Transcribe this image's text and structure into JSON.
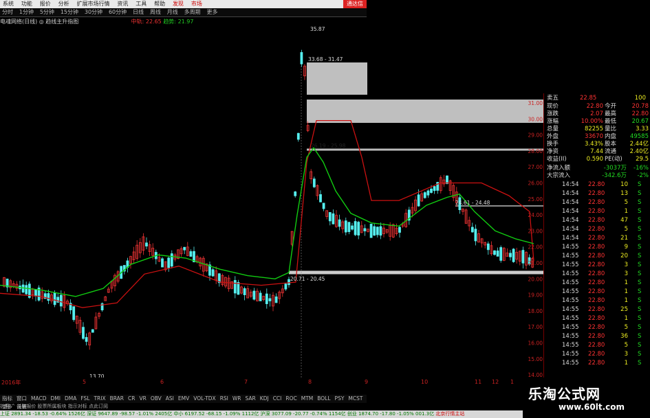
{
  "menu": {
    "items": [
      "系统",
      "功能",
      "报价",
      "分析",
      "扩展市场行情",
      "资讯",
      "工具",
      "帮助"
    ],
    "highlight": [
      "发现",
      "市场"
    ],
    "close": "通达信"
  },
  "periods": [
    "分时",
    "1分钟",
    "5分钟",
    "15分钟",
    "30分钟",
    "60分钟",
    "日线",
    "周线",
    "月线",
    "多周期",
    "更多"
  ],
  "info": {
    "title": "电魂网络(日线) ◎ 趋线主升指图",
    "mid_label": "中轨:",
    "mid_value": "22.65",
    "trend_label": "趋势:",
    "trend_value": "21.97"
  },
  "chart": {
    "y_labels": [
      "31.00",
      "30.00",
      "29.00",
      "28.00",
      "27.00",
      "26.00",
      "25.00",
      "24.00",
      "23.00",
      "22.00",
      "21.00",
      "20.00",
      "19.00",
      "18.00",
      "17.00",
      "16.00",
      "15.00",
      "14.00"
    ],
    "annotations": {
      "high": "35.87",
      "low": "13.70",
      "zone1": "33.68 - 31.47",
      "zone2": "26.19 - 25.98",
      "zone3": "24.61 - 24.48",
      "zone4": "20.71 - 20.45"
    },
    "date_labels": [
      "2016年",
      "5",
      "6",
      "7",
      "8",
      "9",
      "10",
      "11",
      "12",
      "1"
    ],
    "colors": {
      "up": "#e33",
      "down": "#5ee",
      "green_line": "#1c1",
      "red_line": "#c11"
    }
  },
  "quote": {
    "header": {
      "label": "卖五",
      "price": "22.85",
      "vol": "100",
      "top": "22.88"
    },
    "rows": [
      {
        "l1": "现价",
        "v1": "22.80",
        "l2": "今开",
        "v2": "20.78"
      },
      {
        "l1": "涨跌",
        "v1": "2.07",
        "l2": "最高",
        "v2": "22.80"
      },
      {
        "l1": "涨幅",
        "v1": "10.00%",
        "l2": "最低",
        "v2": "20.67"
      },
      {
        "l1": "总量",
        "v1": "82255",
        "l2": "量比",
        "v2": "3.33"
      },
      {
        "l1": "外盘",
        "v1": "33670",
        "l2": "内盘",
        "v2": "49585"
      },
      {
        "l1": "换手",
        "v1": "3.43%",
        "l2": "股本",
        "v2": "2.44亿"
      },
      {
        "l1": "净资",
        "v1": "7.44",
        "l2": "流通",
        "v2": "2.40亿"
      },
      {
        "l1": "收益(II)",
        "v1": "0.590",
        "l2": "PE(动)",
        "v2": "29.5"
      }
    ],
    "flows": [
      {
        "label": "净流入额",
        "value": "-3037万",
        "pct": "-16%"
      },
      {
        "label": "大宗流入",
        "value": "-342.6万",
        "pct": "-2%"
      }
    ],
    "ticks": [
      {
        "t": "14:54",
        "p": "22.80",
        "v": "10",
        "s": "S"
      },
      {
        "t": "14:54",
        "p": "22.80",
        "v": "13",
        "s": "S"
      },
      {
        "t": "14:54",
        "p": "22.80",
        "v": "5",
        "s": "S"
      },
      {
        "t": "14:54",
        "p": "22.80",
        "v": "1",
        "s": "S"
      },
      {
        "t": "14:54",
        "p": "22.80",
        "v": "47",
        "s": "S"
      },
      {
        "t": "14:54",
        "p": "22.80",
        "v": "5",
        "s": "S"
      },
      {
        "t": "14:54",
        "p": "22.80",
        "v": "21",
        "s": "S"
      },
      {
        "t": "14:55",
        "p": "22.80",
        "v": "9",
        "s": "S"
      },
      {
        "t": "14:55",
        "p": "22.80",
        "v": "20",
        "s": "S"
      },
      {
        "t": "14:55",
        "p": "22.80",
        "v": "3",
        "s": "S"
      },
      {
        "t": "14:55",
        "p": "22.80",
        "v": "3",
        "s": "S"
      },
      {
        "t": "14:55",
        "p": "22.80",
        "v": "1",
        "s": "S"
      },
      {
        "t": "14:55",
        "p": "22.80",
        "v": "1",
        "s": "S"
      },
      {
        "t": "14:55",
        "p": "22.80",
        "v": "1",
        "s": "S"
      },
      {
        "t": "14:55",
        "p": "22.80",
        "v": "25",
        "s": "S"
      },
      {
        "t": "14:55",
        "p": "22.80",
        "v": "1",
        "s": "S"
      },
      {
        "t": "14:55",
        "p": "22.80",
        "v": "5",
        "s": "S"
      },
      {
        "t": "14:55",
        "p": "22.80",
        "v": "36",
        "s": "S"
      },
      {
        "t": "14:55",
        "p": "22.80",
        "v": "5",
        "s": "S"
      },
      {
        "t": "14:55",
        "p": "22.80",
        "v": "3",
        "s": "S"
      },
      {
        "t": "14:55",
        "p": "22.80",
        "v": "1",
        "s": "S"
      }
    ]
  },
  "indicators": [
    "指标",
    "窗口",
    "MACD",
    "DMI",
    "DMA",
    "FSL",
    "TRIX",
    "BRAR",
    "CR",
    "VR",
    "OBV",
    "ASI",
    "EMV",
    "VOL-TDX",
    "RSI",
    "WR",
    "SAR",
    "KDJ",
    "CCI",
    "ROC",
    "MTM",
    "BOLL",
    "PSY",
    "MCST",
    "更多",
    "设置"
  ],
  "links": "扩展 ^ 关联报价 股票所属板块 指示对标 点此订阅",
  "status": [
    {
      "text": "上证 2891.34 -18.53 -0.64% 1526亿",
      "tone": "grn"
    },
    {
      "text": "深证 9647.89 -98.57 -1.01% 2405亿",
      "tone": "grn"
    },
    {
      "text": "中小 6197.52 -68.15 -1.09% 1112亿",
      "tone": "grn"
    },
    {
      "text": "沪深 3077.09 -20.77 -0.74% 1154亿",
      "tone": "grn"
    },
    {
      "text": "创业 1874.70 -17.80 -1.05% 001.3亿",
      "tone": "grn"
    },
    {
      "text": "北京行情主站",
      "tone": "red"
    }
  ],
  "logo": {
    "title": "乐淘公式网",
    "url": "www.60lt.com"
  }
}
